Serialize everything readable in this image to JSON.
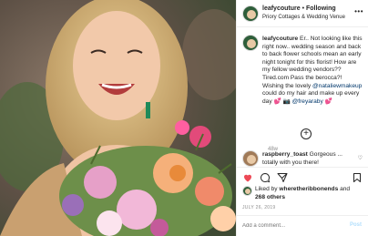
{
  "post": {
    "username": "leafycouture",
    "separator": "•",
    "follow_state": "Following",
    "location": "Priory Cottages & Wedding Venue",
    "more_icon": "more-horizontal-icon"
  },
  "caption": {
    "username": "leafycouture",
    "text_intro": " Er.. Not looking like this right now.. wedding season and back to back flower schools mean an early night tonight for this florist! How are my fellow wedding vendors?? Tired.com Pass the berocca?! Wishing the lovely ",
    "mention_1": "@nataliewmakeup",
    "text_mid": " could do my hair and make up every day 💕 📷 ",
    "mention_2": "@freyaraby",
    "text_end": " 💕",
    "time": "48w"
  },
  "load_more_label": "+",
  "comment": {
    "username": "raspberry_toast",
    "text": " Gorgeous ... totally with you there!",
    "heart_icon": "heart-outline-icon"
  },
  "actions": {
    "like_icon": "heart-filled-icon",
    "comment_icon": "comment-icon",
    "share_icon": "share-icon",
    "save_icon": "bookmark-icon",
    "like_color": "#ed4956"
  },
  "likes": {
    "prefix": "Liked by ",
    "user": "wheretheribbonends",
    "middle": " and ",
    "count": "268 others"
  },
  "date": "JULY 26, 2019",
  "add_comment": {
    "placeholder": "Add a comment...",
    "post_label": "Post"
  }
}
